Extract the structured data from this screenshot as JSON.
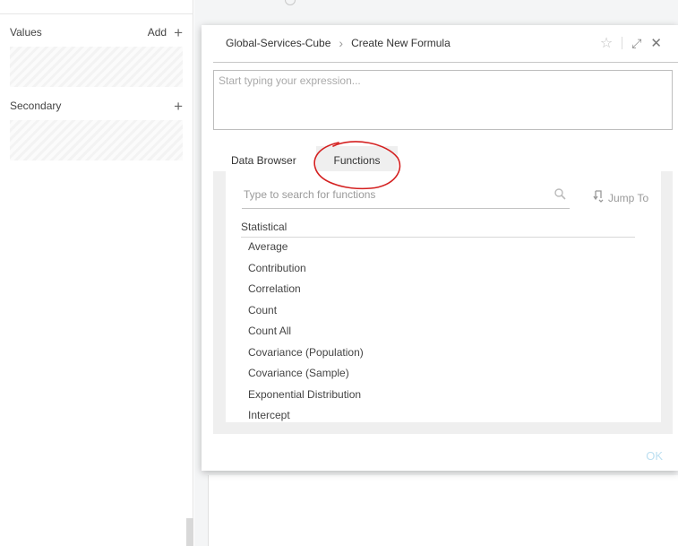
{
  "left_panel": {
    "values_label": "Values",
    "add_label": "Add",
    "secondary_label": "Secondary"
  },
  "dialog": {
    "breadcrumb_root": "Global-Services-Cube",
    "breadcrumb_current": "Create New Formula",
    "expression_placeholder": "Start typing your expression...",
    "tabs": [
      {
        "label": "Data Browser",
        "selected": false
      },
      {
        "label": "Functions",
        "selected": true
      }
    ],
    "search_placeholder": "Type to search for functions",
    "jump_to_label": "Jump To",
    "category": "Statistical",
    "functions": [
      "Average",
      "Contribution",
      "Correlation",
      "Count",
      "Count All",
      "Covariance (Population)",
      "Covariance (Sample)",
      "Exponential Distribution",
      "Intercept"
    ],
    "ok_label": "OK"
  },
  "colors": {
    "annotation": "#d42020",
    "ok_disabled": "#bcdff1",
    "panel_bg": "#efefef"
  },
  "icons": [
    "plus-icon",
    "star-icon",
    "expand-icon",
    "close-icon",
    "search-icon",
    "jump-icon",
    "chevron-right-icon"
  ]
}
